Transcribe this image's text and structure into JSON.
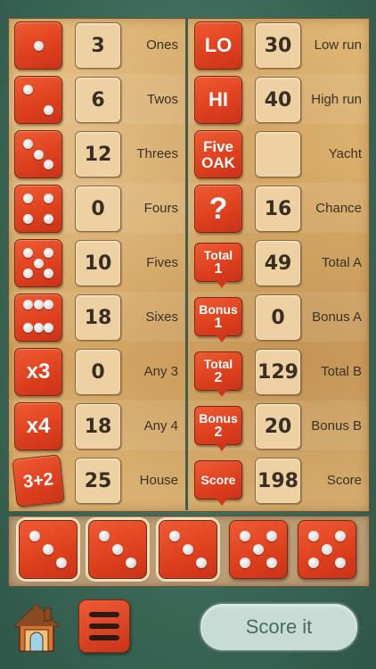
{
  "left_rows": [
    {
      "icon": "die-1",
      "score": "3",
      "label": "Ones"
    },
    {
      "icon": "die-2",
      "score": "6",
      "label": "Twos"
    },
    {
      "icon": "die-3",
      "score": "12",
      "label": "Threes"
    },
    {
      "icon": "die-4",
      "score": "0",
      "label": "Fours"
    },
    {
      "icon": "die-5",
      "score": "10",
      "label": "Fives"
    },
    {
      "icon": "die-6",
      "score": "18",
      "label": "Sixes"
    },
    {
      "icon": "any3",
      "icon_text": "x3",
      "score": "0",
      "label": "Any 3"
    },
    {
      "icon": "any4",
      "icon_text": "x4",
      "score": "18",
      "label": "Any 4"
    },
    {
      "icon": "house",
      "icon_text": "3+2",
      "score": "25",
      "label": "House"
    }
  ],
  "right_rows": [
    {
      "icon": "low-run",
      "icon_text": "LO",
      "score": "30",
      "label": "Low run"
    },
    {
      "icon": "high-run",
      "icon_text": "HI",
      "score": "40",
      "label": "High run"
    },
    {
      "icon": "five-oak",
      "icon_text_1": "Five",
      "icon_text_2": "OAK",
      "score": "",
      "label": "Yacht"
    },
    {
      "icon": "chance",
      "icon_text": "?",
      "score": "16",
      "label": "Chance"
    },
    {
      "icon": "total1",
      "icon_text_1": "Total",
      "icon_text_2": "1",
      "score": "49",
      "label": "Total A"
    },
    {
      "icon": "bonus1",
      "icon_text_1": "Bonus",
      "icon_text_2": "1",
      "score": "0",
      "label": "Bonus A"
    },
    {
      "icon": "total2",
      "icon_text_1": "Total",
      "icon_text_2": "2",
      "score": "129",
      "label": "Total B"
    },
    {
      "icon": "bonus2",
      "icon_text_1": "Bonus",
      "icon_text_2": "2",
      "score": "20",
      "label": "Bonus B"
    },
    {
      "icon": "score",
      "icon_text": "Score",
      "score": "198",
      "label": "Score"
    }
  ],
  "dice": [
    {
      "value": 3,
      "held": true
    },
    {
      "value": 3,
      "held": true
    },
    {
      "value": 3,
      "held": true
    },
    {
      "value": 5,
      "held": false
    },
    {
      "value": 5,
      "held": false
    }
  ],
  "actions": {
    "score_button": "Score it"
  },
  "icons": {
    "home": "home-icon",
    "menu": "menu-icon"
  },
  "colors": {
    "accent": "#dd3f1c",
    "board": "#d8ab67",
    "frame": "#3d6a5b"
  }
}
